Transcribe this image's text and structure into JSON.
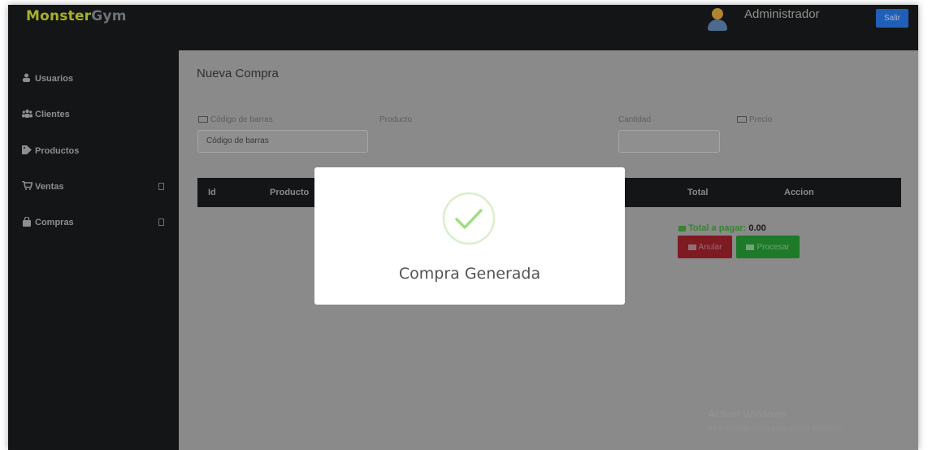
{
  "header": {
    "brand_part1": "Monster",
    "brand_part2": "Gym",
    "user_name": "Administrador",
    "logout_label": "Salir"
  },
  "sidebar": {
    "items": [
      {
        "label": "Usuarios",
        "icon": "user-icon"
      },
      {
        "label": "Clientes",
        "icon": "users-icon"
      },
      {
        "label": "Productos",
        "icon": "tag-icon"
      },
      {
        "label": "Ventas",
        "icon": "cart-icon",
        "has_submenu": true
      },
      {
        "label": "Compras",
        "icon": "bag-icon",
        "has_submenu": true
      }
    ]
  },
  "main": {
    "title": "Nueva Compra",
    "fields": {
      "barcode_label": "Código de barras",
      "barcode_placeholder": "Código de barras",
      "product_label": "Producto",
      "quantity_label": "Cantidad",
      "price_label": "Precio"
    },
    "table": {
      "columns": [
        "Id",
        "Producto",
        "Total",
        "Accion"
      ]
    },
    "total_label": "Total a pagar:",
    "total_value": "0.00",
    "anular_label": "Anular",
    "procesar_label": "Procesar"
  },
  "modal": {
    "title": "Compra Generada",
    "icon": "success-check-icon"
  },
  "watermark": {
    "title": "Activar Windows",
    "subtitle": "Ve a Configuración para activar Windows."
  },
  "colors": {
    "topbar": "#141516",
    "brand_accent": "#a5b12a",
    "success": "#35852c",
    "danger": "#7e1a22",
    "primary": "#1f5fb8",
    "check": "#a5dc86"
  }
}
